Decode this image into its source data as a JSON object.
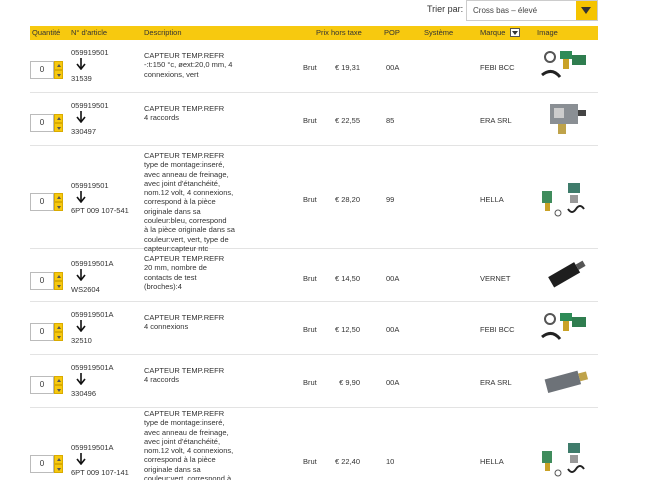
{
  "sort": {
    "label": "Trier par:",
    "value": "Cross bas – élevé"
  },
  "headers": {
    "quantite": "Quantité",
    "article": "N° d'article",
    "description": "Description",
    "prix": "Prix hors taxe",
    "pop": "POP",
    "systeme": "Système",
    "marque": "Marque",
    "image": "Image"
  },
  "rows": [
    {
      "qty": "0",
      "article": "059919501",
      "cross": "31539",
      "desc": "CAPTEUR TEMP.REFR\n-:t:150 °c, øext:20,0 mm, 4\nconnexions, vert",
      "type": "Brut",
      "price": "€ 19,31",
      "pop": "00A",
      "brand": "FEBI BCC",
      "image": "sensor-green-clip"
    },
    {
      "qty": "0",
      "article": "059919501",
      "cross": "330497",
      "desc": "CAPTEUR TEMP.REFR\n4 raccords",
      "type": "Brut",
      "price": "€ 22,55",
      "pop": "85",
      "brand": "ERA SRL",
      "image": "sensor-grey-block"
    },
    {
      "qty": "0",
      "article": "059919501",
      "cross": "6PT 009 107-541",
      "desc": "CAPTEUR TEMP.REFR\ntype de montage:inseré,\navec anneau de freinage,\navec joint d'étanchéité,\nnom.12 volt, 4 connexions,\ncorrespond à la pièce\noriginale dans sa\ncouleur:bleu, correspond\nà la pièce originale dans sa\ncouleur:vert, vert, type de\ncapteur:capteur ntc",
      "type": "Brut",
      "price": "€ 28,20",
      "pop": "99",
      "brand": "HELLA",
      "image": "sensor-brass-set"
    },
    {
      "qty": "0",
      "article": "059919501A",
      "cross": "WS2604",
      "desc": "CAPTEUR TEMP.REFR\n20 mm, nombre de\ncontacts de test\n(broches):4",
      "type": "Brut",
      "price": "€ 14,50",
      "pop": "00A",
      "brand": "VERNET",
      "image": "sensor-black"
    },
    {
      "qty": "0",
      "article": "059919501A",
      "cross": "32510",
      "desc": "CAPTEUR TEMP.REFR\n4 connexions",
      "type": "Brut",
      "price": "€ 12,50",
      "pop": "00A",
      "brand": "FEBI BCC",
      "image": "sensor-green-clip"
    },
    {
      "qty": "0",
      "article": "059919501A",
      "cross": "330496",
      "desc": "CAPTEUR TEMP.REFR\n4 raccords",
      "type": "Brut",
      "price": "€ 9,90",
      "pop": "00A",
      "brand": "ERA SRL",
      "image": "sensor-grey"
    },
    {
      "qty": "0",
      "article": "059919501A",
      "cross": "6PT 009 107-141",
      "desc": "CAPTEUR TEMP.REFR\ntype de montage:inseré,\navec anneau de freinage,\navec joint d'étanchéité,\nnom.12 volt, 4 connexions,\ncorrespond à la pièce\noriginale dans sa\ncouleur:vert, correspond à",
      "type": "Brut",
      "price": "€ 22,40",
      "pop": "10",
      "brand": "HELLA",
      "image": "sensor-brass-set"
    }
  ]
}
